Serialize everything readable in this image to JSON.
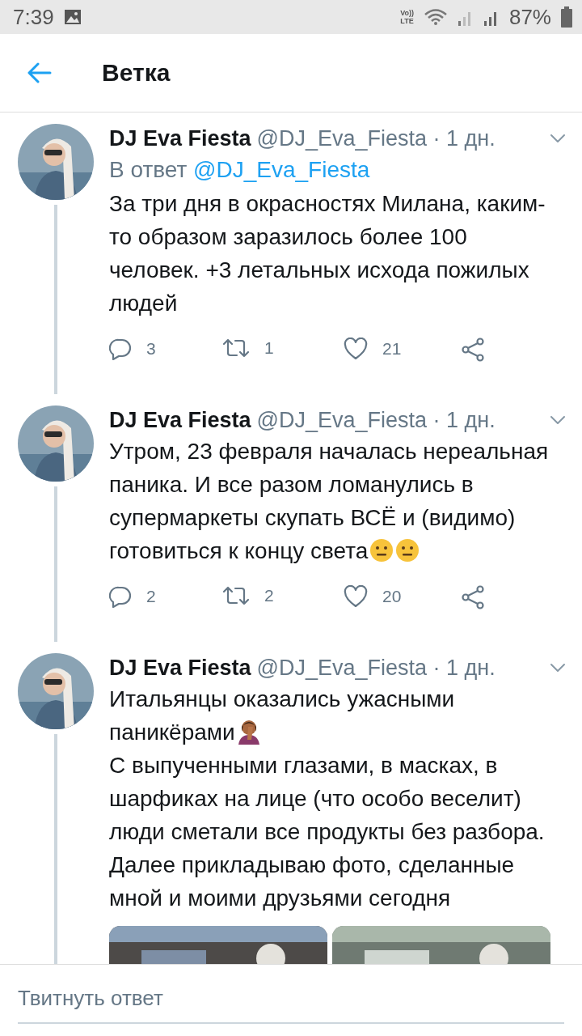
{
  "status_bar": {
    "time": "7:39",
    "volte": [
      "Vo))",
      "LTE"
    ],
    "battery": "87%"
  },
  "header": {
    "title": "Ветка"
  },
  "tweets": [
    {
      "name": "DJ Eva Fiesta",
      "handle": "@DJ_Eva_Fiesta · 1 дн.",
      "reply_prefix": "В ответ",
      "reply_to": "@DJ_Eva_Fiesta",
      "paragraphs": [
        {
          "text": "За три дня в окрасностях Милана, каким-то образом заразилось более 100 человек. +3 летальных исхода пожилых людей"
        }
      ],
      "actions": {
        "replies": "3",
        "retweets": "1",
        "likes": "21"
      }
    },
    {
      "name": "DJ Eva Fiesta",
      "handle": "@DJ_Eva_Fiesta · 1 дн.",
      "paragraphs": [
        {
          "text": "Утром, 23 февраля началась нереальная паника. И все разом ломанулись в супермаркеты скупать ВСЁ и (видимо) готовиться к концу света",
          "emoji": [
            {
              "kind": "neutral"
            },
            {
              "kind": "neutral"
            }
          ]
        }
      ],
      "actions": {
        "replies": "2",
        "retweets": "2",
        "likes": "20"
      }
    },
    {
      "name": "DJ Eva Fiesta",
      "handle": "@DJ_Eva_Fiesta · 1 дн.",
      "paragraphs": [
        {
          "text": "Итальянцы оказались ужасными паникёрами",
          "emoji": [
            {
              "kind": "facepalm"
            }
          ]
        },
        {
          "text": "С выпученными глазами, в масках, в шарфиках на лице (что особо веселит) люди сметали все продукты без разбора."
        },
        {
          "text": "Далее прикладываю фото, сделанные мной и моими друзьями сегодня"
        }
      ]
    }
  ],
  "reply_bar": {
    "placeholder": "Твитнуть ответ"
  }
}
